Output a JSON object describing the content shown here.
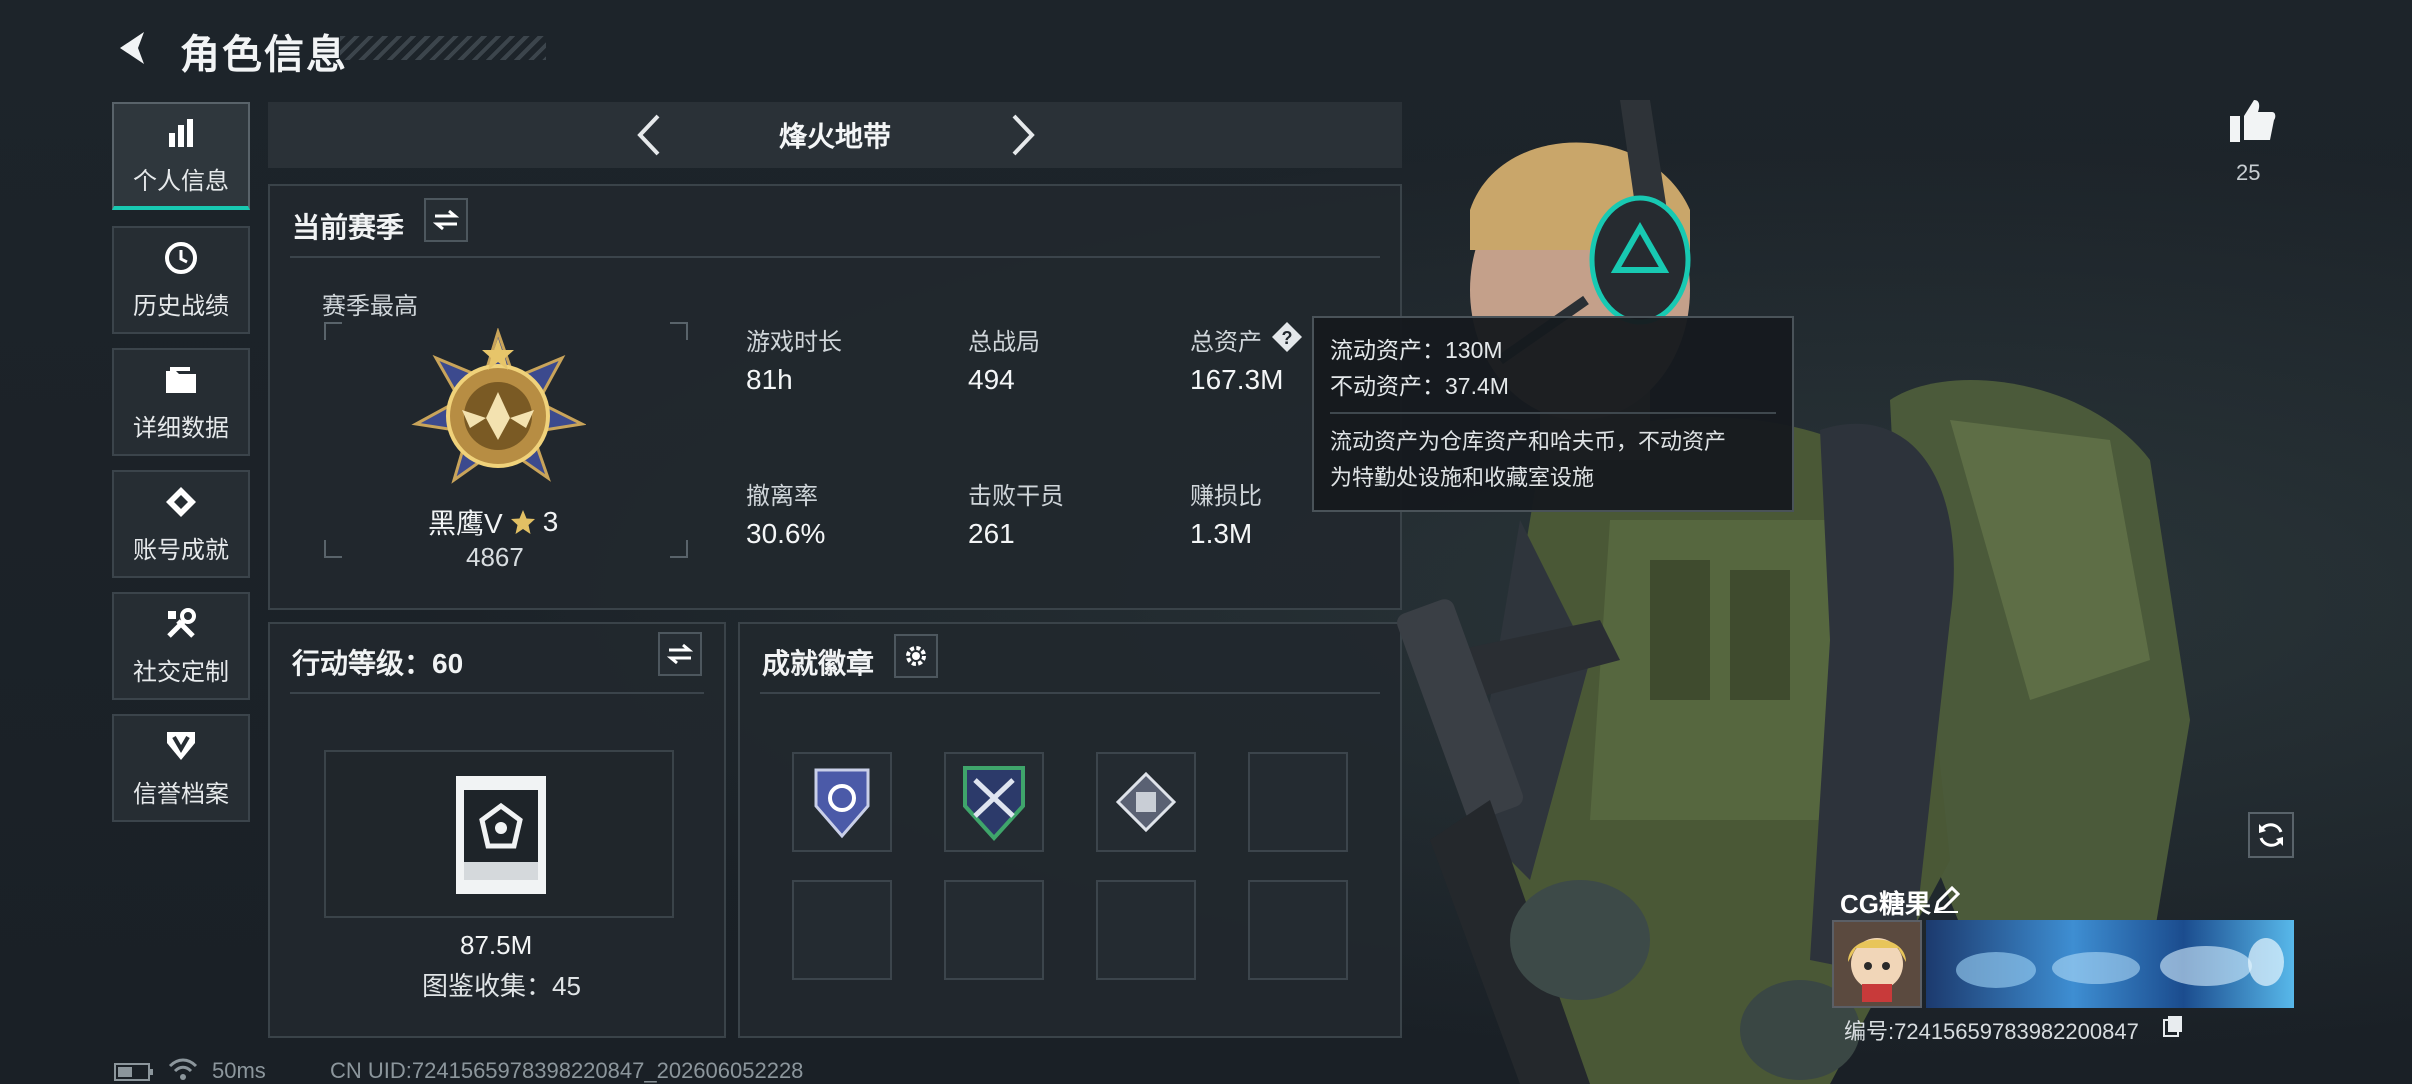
{
  "header": {
    "title": "角色信息"
  },
  "sidebar": {
    "items": [
      {
        "label": "个人信息",
        "icon": "bar-chart-icon",
        "active": true
      },
      {
        "label": "历史战绩",
        "icon": "history-clock-icon",
        "active": false
      },
      {
        "label": "详细数据",
        "icon": "folder-icon",
        "active": false
      },
      {
        "label": "账号成就",
        "icon": "achievement-icon",
        "active": false
      },
      {
        "label": "社交定制",
        "icon": "tools-icon",
        "active": false
      },
      {
        "label": "信誉档案",
        "icon": "shield-badge-icon",
        "active": false
      }
    ]
  },
  "mode": {
    "label": "烽火地带"
  },
  "season": {
    "title": "当前赛季",
    "best_label": "赛季最高",
    "rank_name": "黑鹰V",
    "rank_stars": "3",
    "rank_score": "4867",
    "stats": [
      {
        "label": "游戏时长",
        "value": "81h"
      },
      {
        "label": "总战局",
        "value": "494"
      },
      {
        "label": "总资产",
        "value": "167.3M"
      },
      {
        "label": "撤离率",
        "value": "30.6%"
      },
      {
        "label": "击败干员",
        "value": "261"
      },
      {
        "label": "赚损比",
        "value": "1.3M"
      }
    ]
  },
  "tooltip": {
    "liquid": "流动资产：130M",
    "fixed": "不动资产：37.4M",
    "desc_line1": "流动资产为仓库资产和哈夫币，不动资产",
    "desc_line2": "为特勤处设施和收藏室设施"
  },
  "action_level": {
    "title": "行动等级：60",
    "value": "87.5M",
    "collection": "图鉴收集：45"
  },
  "achievements": {
    "title": "成就徽章",
    "badges_filled": 3,
    "slots": 8
  },
  "profile": {
    "likes": "25",
    "name": "CG糖果",
    "id": "编号:7241565978398220084",
    "id_suffix": "7"
  },
  "status_bar": {
    "ping": "50ms",
    "uid": "CN UID:7241565978398220847_202606052228"
  },
  "colors": {
    "accent": "#18c9b2",
    "panel": "#22282e",
    "background": "#1b2127"
  }
}
